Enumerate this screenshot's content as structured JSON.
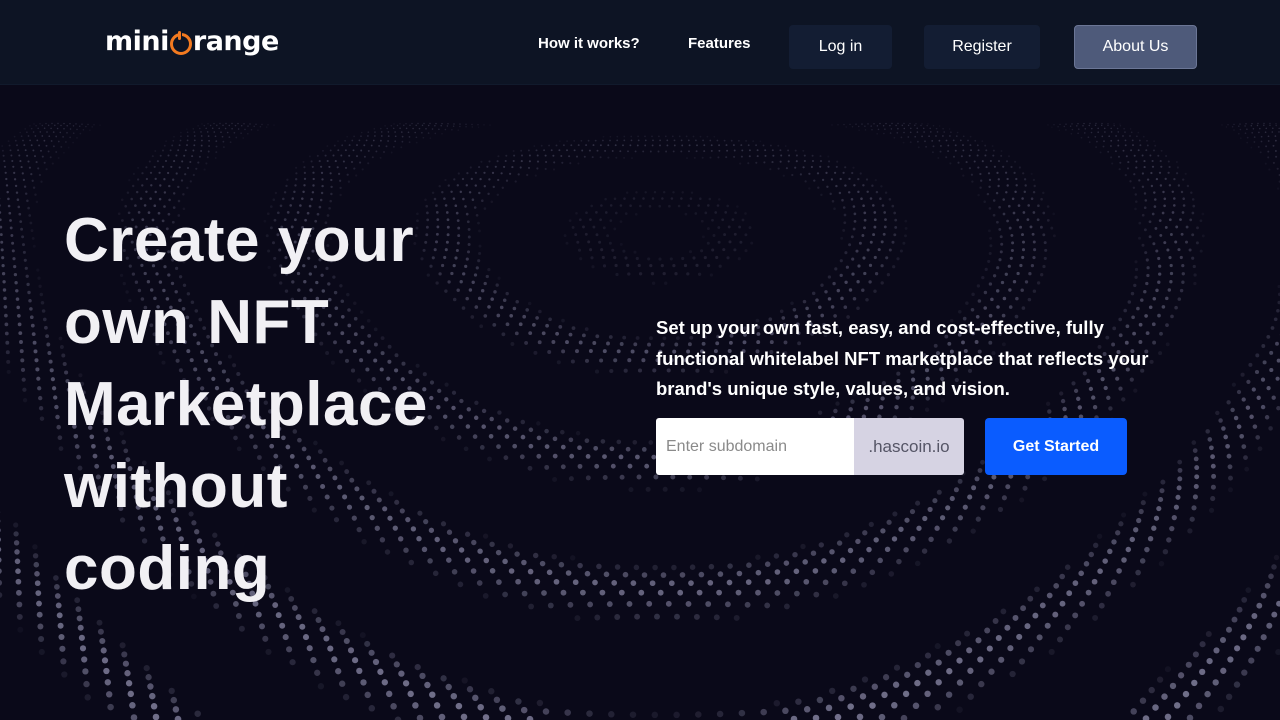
{
  "brand": {
    "logo_text_left": "mini",
    "logo_text_right": "range",
    "accent_color": "#f37a20"
  },
  "nav": {
    "links": [
      "How it works?",
      "Features"
    ],
    "buttons": [
      "Log in",
      "Register",
      "About Us"
    ]
  },
  "hero": {
    "headline_lines": [
      "Create your",
      "own NFT",
      "Marketplace",
      "without",
      "coding"
    ],
    "description": "Set up your own fast, easy, and cost-effective, fully functional whitelabel NFT marketplace that reflects your brand's unique style, values, and vision.",
    "subdomain_placeholder": "Enter subdomain",
    "subdomain_value": "",
    "domain_suffix": ".hascoin.io",
    "cta_label": "Get Started",
    "cta_color": "#0a5cff",
    "background_pattern": "dotted-wave-particles"
  }
}
